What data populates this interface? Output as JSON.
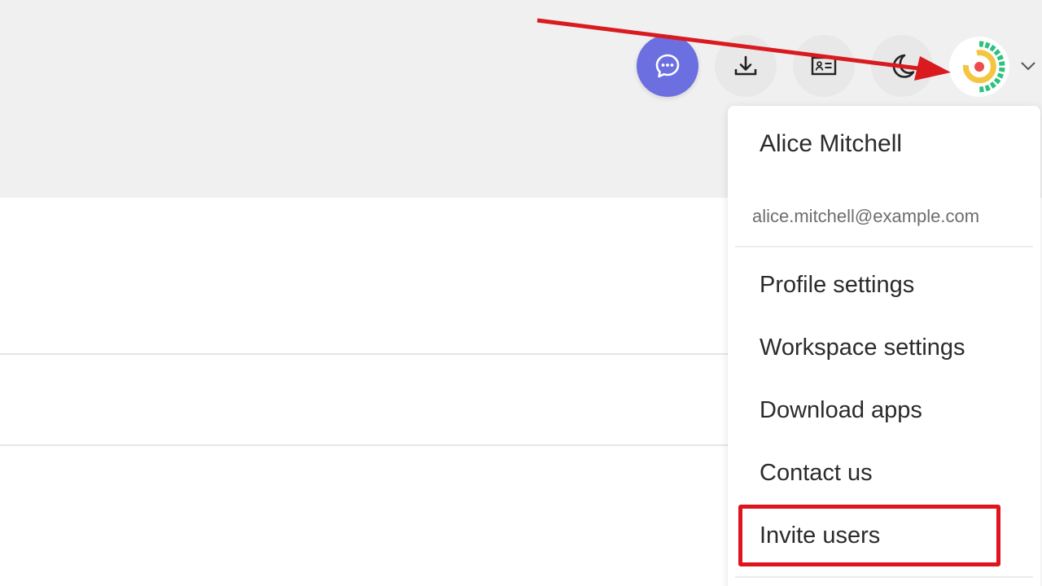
{
  "toolbar": {
    "buttons": [
      {
        "icon": "chat-bubble-icon",
        "accent": "#6b6fe0"
      },
      {
        "icon": "download-icon"
      },
      {
        "icon": "contact-card-icon"
      },
      {
        "icon": "moon-icon"
      }
    ],
    "avatar_icon": "logo-avatar-icon",
    "dropdown_icon": "chevron-down-icon"
  },
  "user_menu": {
    "name": "Alice Mitchell",
    "email": "alice.mitchell@example.com",
    "items": [
      {
        "label": "Profile settings"
      },
      {
        "label": "Workspace settings"
      },
      {
        "label": "Download apps"
      },
      {
        "label": "Contact us"
      },
      {
        "label": "Invite users",
        "highlighted": true
      }
    ]
  },
  "annotation": {
    "highlight_color": "#e0141e",
    "arrow_color": "#d91a1f"
  }
}
